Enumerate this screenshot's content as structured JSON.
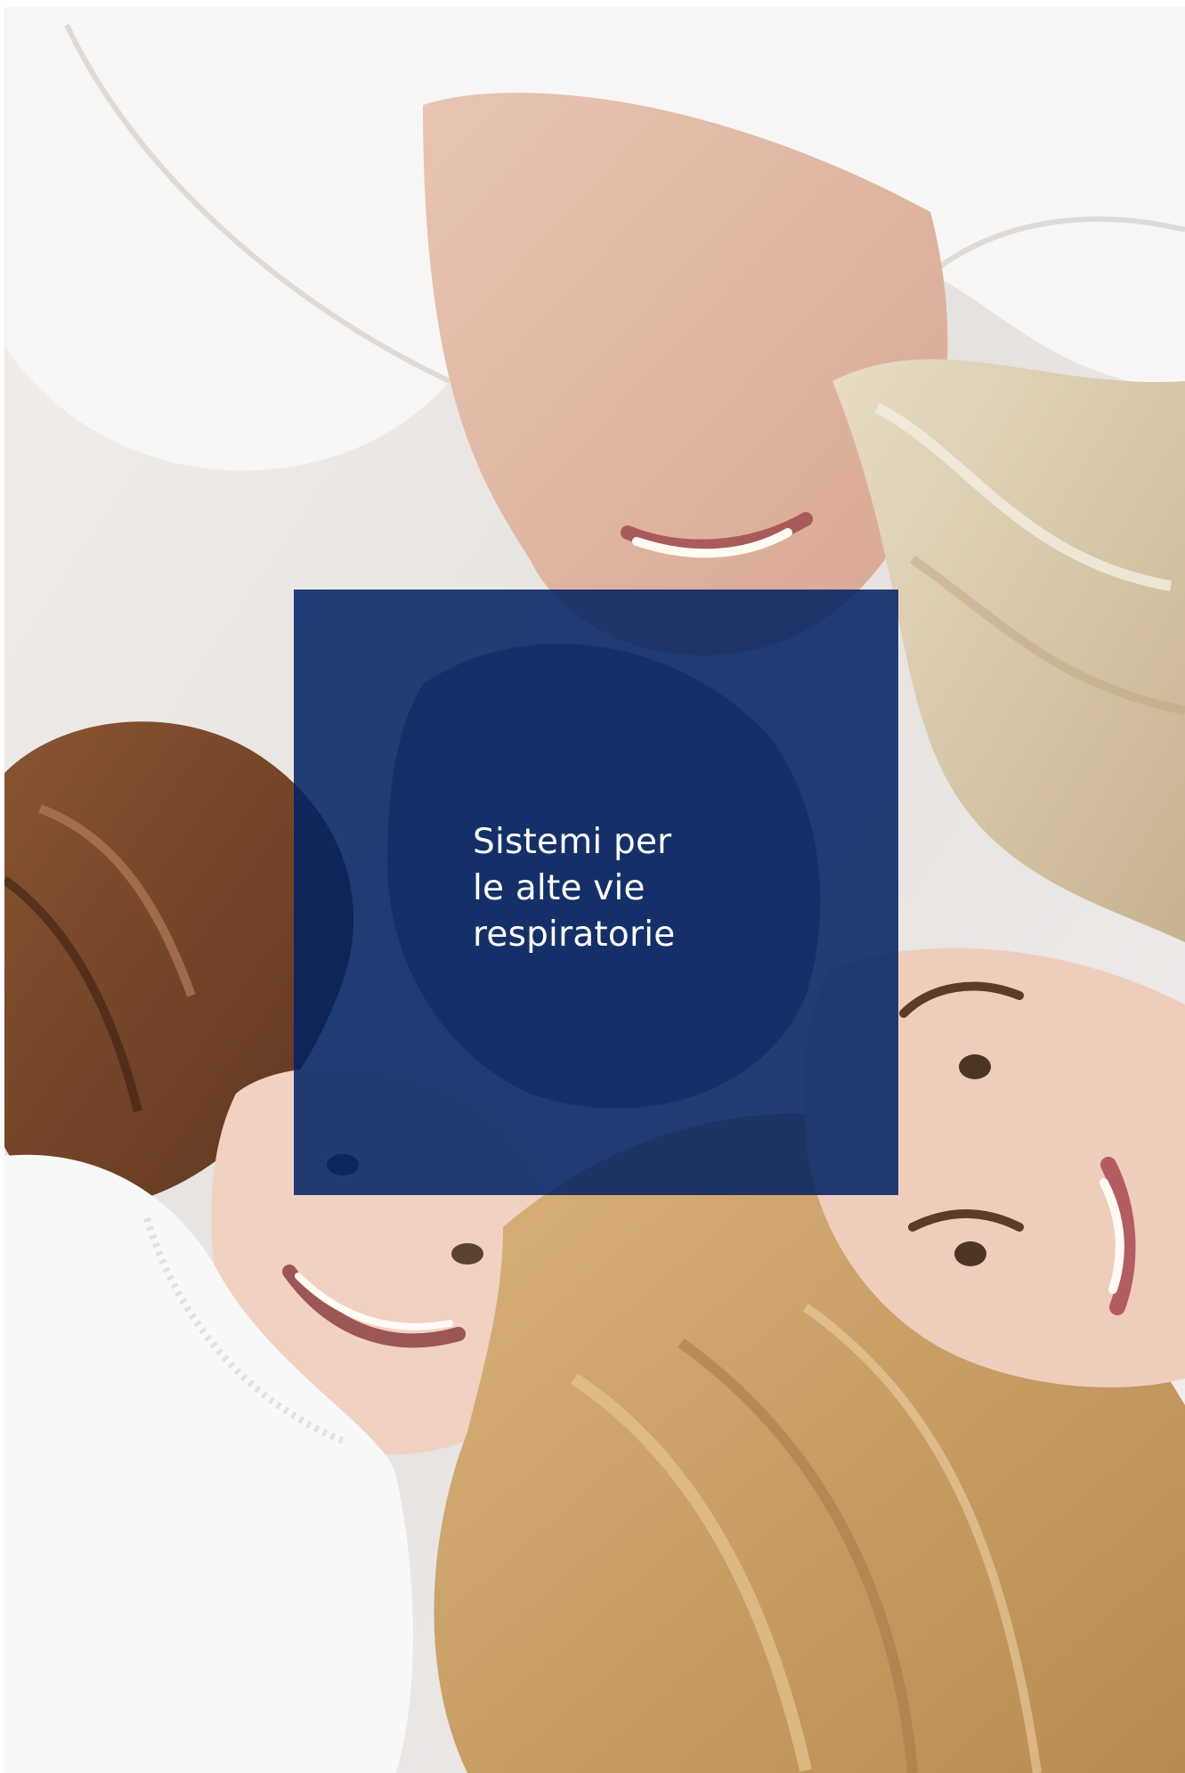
{
  "hero": {
    "headline_lines": [
      "Sistemi per",
      "le alte vie",
      "respiratorie"
    ]
  },
  "colors": {
    "overlay": "#002162",
    "text": "#ffffff",
    "background": "#ffffff"
  },
  "icons": {
    "hero_image": "family-lying-on-bed-photo"
  }
}
